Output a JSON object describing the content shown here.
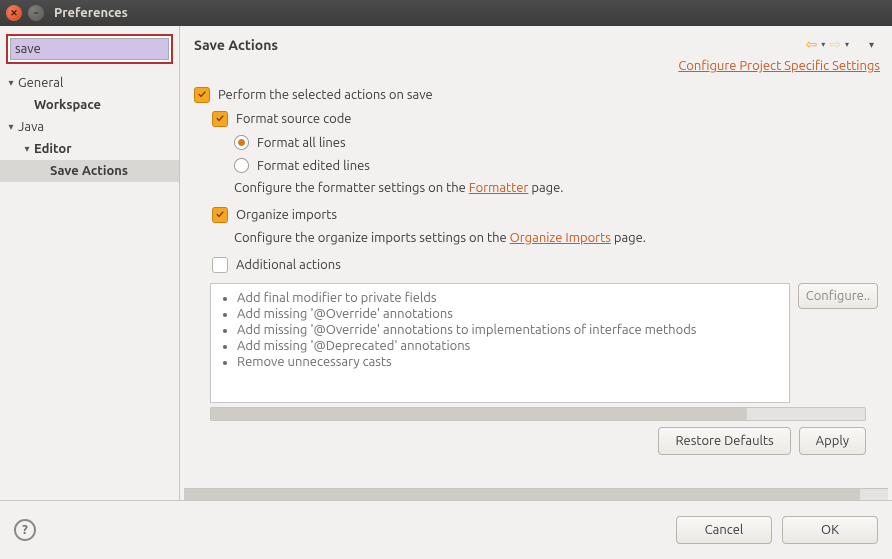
{
  "window": {
    "title": "Preferences"
  },
  "search": {
    "value": "save"
  },
  "tree": [
    {
      "label": "General",
      "level": 0,
      "twisty": "▾",
      "bold": false
    },
    {
      "label": "Workspace",
      "level": 1,
      "twisty": "",
      "bold": true
    },
    {
      "label": "Java",
      "level": 0,
      "twisty": "▾",
      "bold": false
    },
    {
      "label": "Editor",
      "level": 1,
      "twisty": "▾",
      "bold": true
    },
    {
      "label": "Save Actions",
      "level": 2,
      "twisty": "",
      "bold": true,
      "selected": true
    }
  ],
  "page": {
    "title": "Save Actions",
    "projectLink": "Configure Project Specific Settings",
    "opts": {
      "perform": "Perform the selected actions on save",
      "format": "Format source code",
      "formatAll": "Format all lines",
      "formatEdited": "Format edited lines",
      "formatterHint_a": "Configure the formatter settings on the ",
      "formatterHint_link": "Formatter",
      "formatterHint_b": " page.",
      "organize": "Organize imports",
      "organizeHint_a": "Configure the organize imports settings on the ",
      "organizeHint_link": "Organize Imports",
      "organizeHint_b": " page.",
      "additional": "Additional actions",
      "configureBtn": "Configure..",
      "actionsList": [
        "Add final modifier to private fields",
        "Add missing '@Override' annotations",
        "Add missing '@Override' annotations to implementations of interface methods",
        "Add missing '@Deprecated' annotations",
        "Remove unnecessary casts"
      ]
    },
    "restoreDefaults": "Restore Defaults",
    "apply": "Apply"
  },
  "footer": {
    "cancel": "Cancel",
    "ok": "OK"
  }
}
